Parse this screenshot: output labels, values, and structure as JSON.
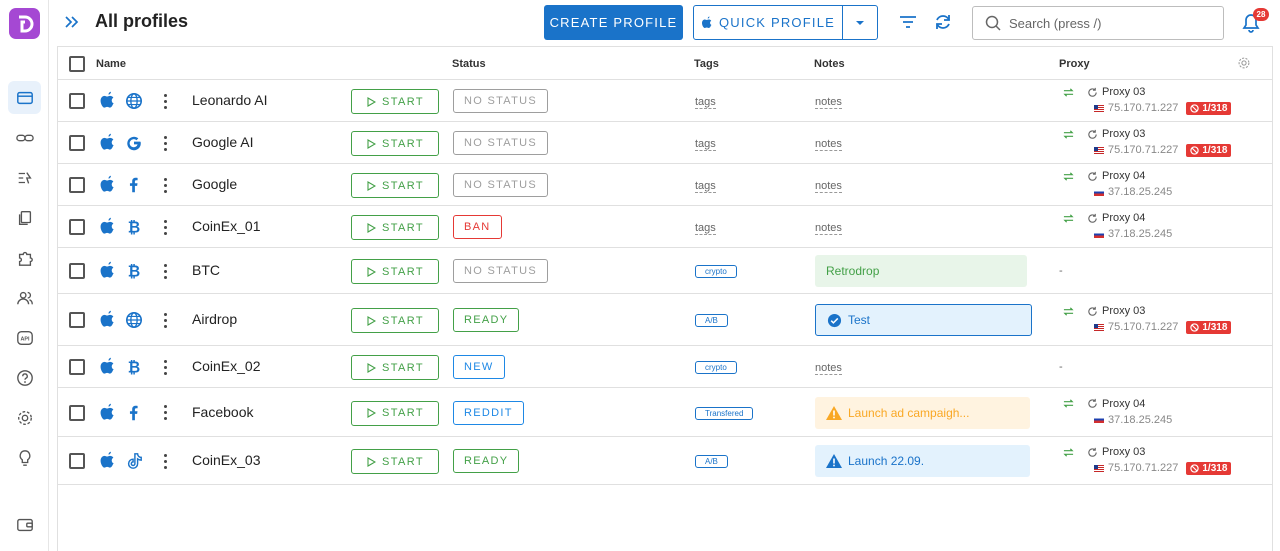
{
  "app": {
    "title": "All profiles",
    "logo": "D",
    "notif_count": "28"
  },
  "toolbar": {
    "create_label": "CREATE PROFILE",
    "quick_label": "QUICK PROFILE",
    "search_placeholder": "Search (press /)"
  },
  "sidebar": {
    "items": [
      "profiles",
      "links",
      "automation",
      "copy",
      "extensions",
      "team",
      "api",
      "help",
      "settings",
      "tips",
      "wallet"
    ]
  },
  "columns": {
    "name": "Name",
    "status": "Status",
    "tags": "Tags",
    "notes": "Notes",
    "proxy": "Proxy"
  },
  "colors": {
    "accent": "#1a73c9",
    "start": "#43a047",
    "ban": "#e53935",
    "ready": "#43a047",
    "new": "#1e88e5",
    "no_status": "#9e9e9e",
    "logo": "#a548d3"
  },
  "rows": [
    {
      "name": "Leonardo AI",
      "os": "apple-icon",
      "browser": "globe-icon",
      "start": "START",
      "status": "NO STATUS",
      "status_type": "none",
      "tags": "tags",
      "tag_type": "link",
      "notes": "notes",
      "note_type": "link",
      "proxy": {
        "name": "Proxy 03",
        "ip": "75.170.71.227",
        "flag": "us",
        "count": "1/318"
      }
    },
    {
      "name": "Google AI",
      "os": "apple-icon",
      "browser": "google-icon",
      "start": "START",
      "status": "NO STATUS",
      "status_type": "none",
      "tags": "tags",
      "tag_type": "link",
      "notes": "notes",
      "note_type": "link",
      "proxy": {
        "name": "Proxy 03",
        "ip": "75.170.71.227",
        "flag": "us",
        "count": "1/318"
      }
    },
    {
      "name": "Google",
      "os": "apple-icon",
      "browser": "facebook-icon",
      "start": "START",
      "status": "NO STATUS",
      "status_type": "none",
      "tags": "tags",
      "tag_type": "link",
      "notes": "notes",
      "note_type": "link",
      "proxy": {
        "name": "Proxy 04",
        "ip": "37.18.25.245",
        "flag": "ru",
        "count": ""
      }
    },
    {
      "name": "CoinEx_01",
      "os": "apple-icon",
      "browser": "bitcoin-icon",
      "start": "START",
      "status": "BAN",
      "status_type": "ban",
      "tags": "tags",
      "tag_type": "link",
      "notes": "notes",
      "note_type": "link",
      "proxy": {
        "name": "Proxy 04",
        "ip": "37.18.25.245",
        "flag": "ru",
        "count": ""
      }
    },
    {
      "name": "BTC",
      "os": "apple-icon",
      "browser": "bitcoin-icon",
      "start": "START",
      "status": "NO STATUS",
      "status_type": "none",
      "tags": "crypto",
      "tag_type": "chip",
      "notes": "Retrodrop",
      "note_type": "green",
      "proxy": null
    },
    {
      "name": "Airdrop",
      "os": "apple-icon",
      "browser": "globe-icon",
      "start": "START",
      "status": "READY",
      "status_type": "ready",
      "tags": "A/B",
      "tag_type": "chip",
      "notes": "Test",
      "note_type": "blue-check",
      "proxy": {
        "name": "Proxy 03",
        "ip": "75.170.71.227",
        "flag": "us",
        "count": "1/318"
      }
    },
    {
      "name": "CoinEx_02",
      "os": "apple-icon",
      "browser": "bitcoin-icon",
      "start": "START",
      "status": "NEW",
      "status_type": "new",
      "tags": "crypto",
      "tag_type": "chip",
      "notes": "notes",
      "note_type": "link",
      "proxy": null
    },
    {
      "name": "Facebook",
      "os": "apple-icon",
      "browser": "facebook-icon",
      "start": "START",
      "status": "REDDIT",
      "status_type": "new",
      "tags": "Transfered",
      "tag_type": "chip",
      "notes": "Launch ad campaigh...",
      "note_type": "orange-warn",
      "proxy": {
        "name": "Proxy 04",
        "ip": "37.18.25.245",
        "flag": "ru",
        "count": ""
      }
    },
    {
      "name": "CoinEx_03",
      "os": "apple-icon",
      "browser": "tiktok-icon",
      "start": "START",
      "status": "READY",
      "status_type": "ready",
      "tags": "A/B",
      "tag_type": "chip",
      "notes": "Launch 22.09.",
      "note_type": "blue-warn",
      "proxy": {
        "name": "Proxy 03",
        "ip": "75.170.71.227",
        "flag": "us",
        "count": "1/318"
      }
    }
  ],
  "empty_proxy": "-"
}
